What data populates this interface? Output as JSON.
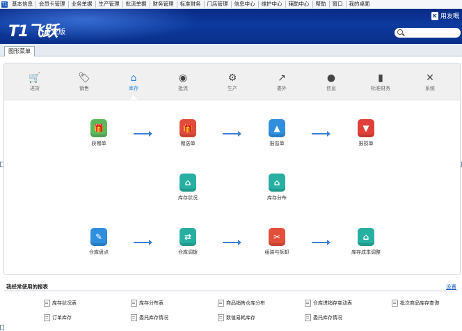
{
  "menubar": {
    "app_icon": "T1",
    "items": [
      "基本信息",
      "会员卡管理",
      "业务单据",
      "生产管理",
      "批流单据",
      "财务管理",
      "标准财务",
      "门店管理",
      "信息中心",
      "维护中心",
      "辅助中心",
      "帮助",
      "窗口",
      "我的桌面"
    ]
  },
  "banner": {
    "logo_main": "T1飞跃",
    "logo_sub": "专业版",
    "user_icon": "K",
    "user_name": "用友嘅"
  },
  "tabs": {
    "graphic_menu": "图形菜单"
  },
  "categories": [
    {
      "icon": "cart-icon",
      "glyph": "🛒",
      "label": "进货"
    },
    {
      "icon": "tag-icon",
      "glyph": "🏷",
      "label": "销售"
    },
    {
      "icon": "home-icon",
      "glyph": "⌂",
      "label": "库存"
    },
    {
      "icon": "coins-icon",
      "glyph": "◉",
      "label": "批流"
    },
    {
      "icon": "gears-icon",
      "glyph": "⚙",
      "label": "生产"
    },
    {
      "icon": "share-icon",
      "glyph": "↗",
      "label": "委外"
    },
    {
      "icon": "chat-icon",
      "glyph": "●",
      "label": "信息"
    },
    {
      "icon": "book-icon",
      "glyph": "▮",
      "label": "标准财务"
    },
    {
      "icon": "tools-icon",
      "glyph": "✕",
      "label": "系统"
    }
  ],
  "active_category": "库存",
  "flow": [
    {
      "name": "gift-order",
      "label": "获赠单",
      "glyph": "🎁",
      "color": "#5cb85c"
    },
    {
      "name": "giveaway-order",
      "label": "赠送单",
      "glyph": "🎁",
      "color": "#e14c3a"
    },
    {
      "name": "overflow-order",
      "label": "报溢单",
      "glyph": "▲",
      "color": "#2f8fdd"
    },
    {
      "name": "loss-order",
      "label": "报损单",
      "glyph": "▼",
      "color": "#e0403a"
    },
    {
      "name": "stock-status",
      "label": "库存状况",
      "glyph": "⌂",
      "color": "#27b0a2"
    },
    {
      "name": "stock-distribution",
      "label": "库存分布",
      "glyph": "⌂",
      "color": "#27b0a2"
    },
    {
      "name": "inventory-check",
      "label": "仓库盘点",
      "glyph": "✎",
      "color": "#2f8fdd"
    },
    {
      "name": "warehouse-transfer",
      "label": "仓库调拨",
      "glyph": "⇄",
      "color": "#27b0a2"
    },
    {
      "name": "assembly-disassembly",
      "label": "组装与拆卸",
      "glyph": "✂",
      "color": "#e0503a"
    },
    {
      "name": "stock-cost-adjust",
      "label": "库存成本调整",
      "glyph": "⌂",
      "color": "#27b0a2"
    }
  ],
  "frequent": {
    "title": "我经常使用的报表",
    "settings": "设置",
    "items": [
      "库存状况表",
      "库存分布表",
      "商品销售仓库分布",
      "仓库进销存变动表",
      "批次商品库存查询",
      "订单库存",
      "委托库存情况",
      "数值易耗库存",
      "委托库存情况"
    ]
  }
}
